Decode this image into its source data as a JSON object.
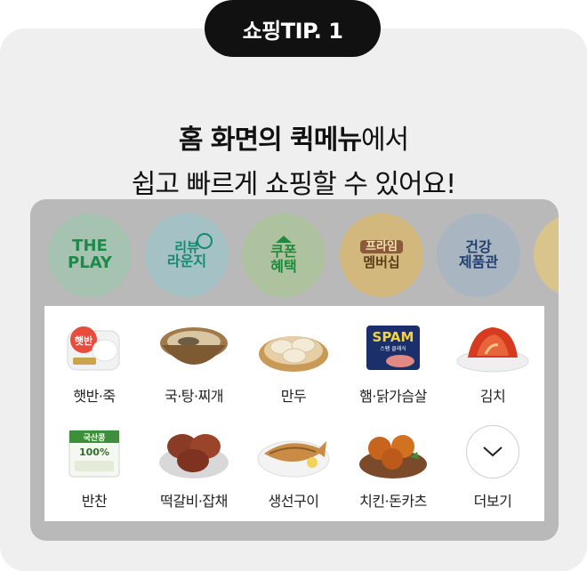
{
  "tip_badge": "쇼핑TIP. 1",
  "headline": {
    "line1_bold": "홈 화면의 퀵메뉴",
    "line1_rest": "에서",
    "line2": "쉽고 빠르게 쇼핑할 수 있어요!"
  },
  "quick_menu": [
    {
      "line1": "THE",
      "line2": "PLAY"
    },
    {
      "line1": "리뷰",
      "line2": "라운지"
    },
    {
      "line1": "쿠폰",
      "line2": "혜택"
    },
    {
      "line1": "프라임",
      "line2": "멤버십"
    },
    {
      "line1": "건강",
      "line2": "제품관"
    }
  ],
  "categories": [
    {
      "label": "햇반·죽",
      "icon": "rice-bowl-icon"
    },
    {
      "label": "국·탕·찌개",
      "icon": "soup-icon"
    },
    {
      "label": "만두",
      "icon": "dumpling-icon"
    },
    {
      "label": "햄·닭가슴살",
      "icon": "ham-can-icon"
    },
    {
      "label": "김치",
      "icon": "kimchi-icon"
    },
    {
      "label": "반찬",
      "icon": "side-dish-icon"
    },
    {
      "label": "떡갈비·잡채",
      "icon": "patty-icon"
    },
    {
      "label": "생선구이",
      "icon": "grilled-fish-icon"
    },
    {
      "label": "치킨·돈카츠",
      "icon": "fried-chicken-icon"
    },
    {
      "label": "더보기",
      "icon": "chevron-down-icon"
    }
  ],
  "product_text": {
    "spam": "SPAM",
    "spam_sub": "스팸 클래식",
    "tofu": "국산콩",
    "tofu_pct": "100%",
    "rice": "햇반"
  },
  "colors": {
    "badge_bg": "#111111",
    "card_bg": "#efefef",
    "dim_bg": "#b9b9b9"
  }
}
